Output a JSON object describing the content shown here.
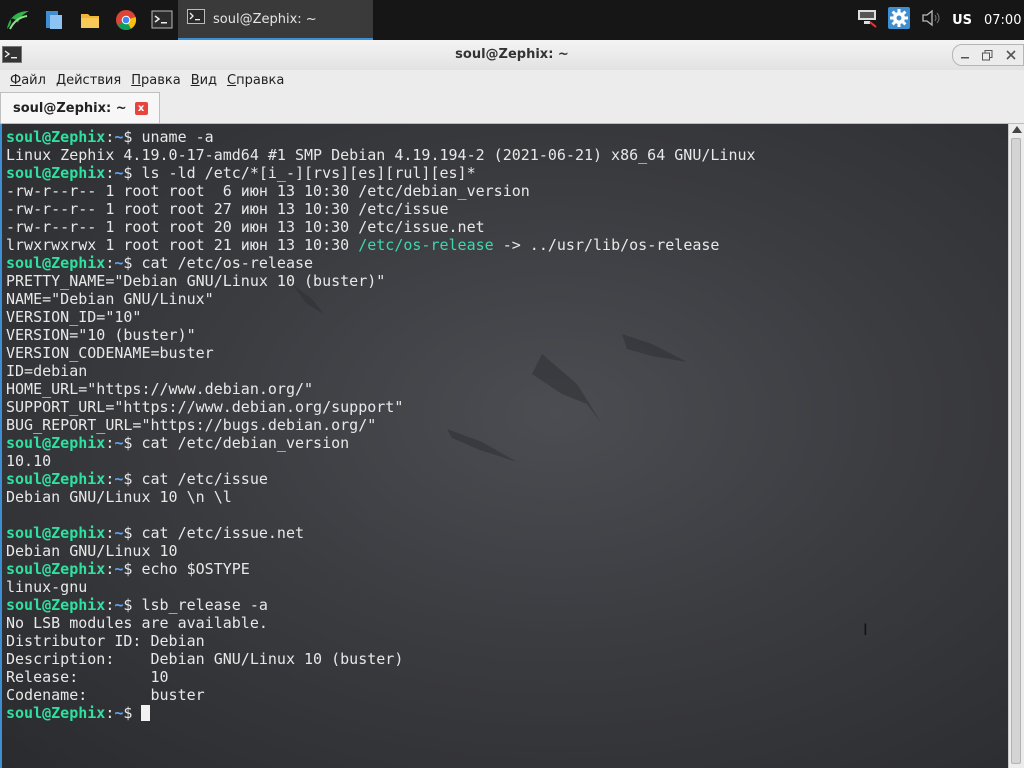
{
  "panel": {
    "launchers": [
      "app-menu-icon",
      "file-manager-icon",
      "home-folder-icon",
      "chrome-icon",
      "terminal-icon"
    ],
    "task_label": "soul@Zephix: ~",
    "keyboard_layout": "US",
    "clock": "07:00",
    "tray_icons": [
      "network-icon",
      "settings-gear-icon",
      "volume-icon"
    ]
  },
  "window": {
    "title": "soul@Zephix: ~",
    "buttons": [
      "minimize",
      "maximize",
      "close"
    ]
  },
  "menu": [
    "Файл",
    "Действия",
    "Правка",
    "Вид",
    "Справка"
  ],
  "tab": {
    "label": "soul@Zephix: ~",
    "close": "x"
  },
  "prompt": {
    "user": "soul@Zephix",
    "path": "~",
    "symbol": "$"
  },
  "terminal": [
    {
      "cmd": "uname -a"
    },
    {
      "out": "Linux Zephix 4.19.0-17-amd64 #1 SMP Debian 4.19.194-2 (2021-06-21) x86_64 GNU/Linux"
    },
    {
      "cmd": "ls -ld /etc/*[i_-][rvs][es][rul][es]*"
    },
    {
      "out": "-rw-r--r-- 1 root root  6 июн 13 10:30 /etc/debian_version"
    },
    {
      "out": "-rw-r--r-- 1 root root 27 июн 13 10:30 /etc/issue"
    },
    {
      "out": "-rw-r--r-- 1 root root 20 июн 13 10:30 /etc/issue.net"
    },
    {
      "link": [
        "lrwxrwxrwx 1 root root 21 июн 13 10:30 ",
        "/etc/os-release",
        " -> ../usr/lib/os-release"
      ]
    },
    {
      "cmd": "cat /etc/os-release"
    },
    {
      "out": "PRETTY_NAME=\"Debian GNU/Linux 10 (buster)\""
    },
    {
      "out": "NAME=\"Debian GNU/Linux\""
    },
    {
      "out": "VERSION_ID=\"10\""
    },
    {
      "out": "VERSION=\"10 (buster)\""
    },
    {
      "out": "VERSION_CODENAME=buster"
    },
    {
      "out": "ID=debian"
    },
    {
      "out": "HOME_URL=\"https://www.debian.org/\""
    },
    {
      "out": "SUPPORT_URL=\"https://www.debian.org/support\""
    },
    {
      "out": "BUG_REPORT_URL=\"https://bugs.debian.org/\""
    },
    {
      "cmd": "cat /etc/debian_version"
    },
    {
      "out": "10.10"
    },
    {
      "cmd": "cat /etc/issue"
    },
    {
      "out": "Debian GNU/Linux 10 \\n \\l"
    },
    {
      "out": ""
    },
    {
      "cmd": "cat /etc/issue.net"
    },
    {
      "out": "Debian GNU/Linux 10"
    },
    {
      "cmd": "echo $OSTYPE"
    },
    {
      "out": "linux-gnu"
    },
    {
      "cmd": "lsb_release -a"
    },
    {
      "out": "No LSB modules are available."
    },
    {
      "out": "Distributor ID:\tDebian"
    },
    {
      "out": "Description:\tDebian GNU/Linux 10 (buster)"
    },
    {
      "out": "Release:\t10"
    },
    {
      "out": "Codename:\tbuster"
    },
    {
      "cmd": "",
      "cursor": true
    }
  ],
  "colors": {
    "prompt_user": "#2fe0a0",
    "prompt_path": "#5aa8ff",
    "symlink": "#3fd6b0",
    "accent": "#3d8fd1",
    "close_tab": "#e5453d"
  }
}
